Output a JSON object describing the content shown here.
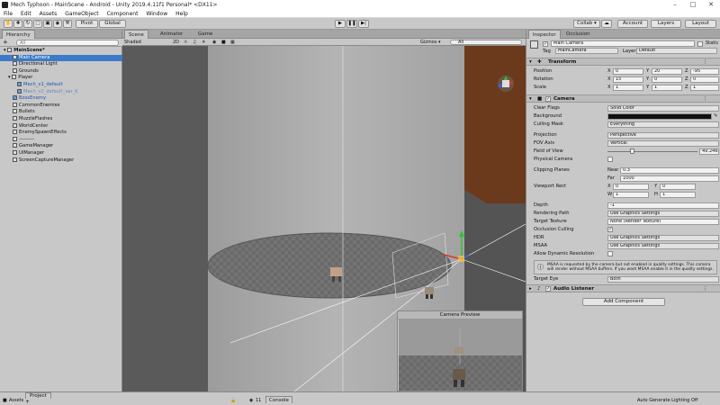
{
  "window": {
    "title": "Mech Typhoon - MainScene - Android - Unity 2019.4.11f1 Personal* <DX11>"
  },
  "menu": [
    "File",
    "Edit",
    "Assets",
    "GameObject",
    "Component",
    "Window",
    "Help"
  ],
  "toolbar": {
    "pivot": "Pivot",
    "global": "Global",
    "collab": "Collab ▾",
    "account": "Account",
    "layers": "Layers",
    "layout": "Layout"
  },
  "hierarchy": {
    "tab": "Hierarchy",
    "create": "+",
    "search_placeholder": "All",
    "items": [
      {
        "label": "MainScene*",
        "depth": 0,
        "kind": "scene"
      },
      {
        "label": "Main Camera",
        "depth": 2,
        "kind": "selected"
      },
      {
        "label": "Directional Light",
        "depth": 2,
        "kind": "normal"
      },
      {
        "label": "Grounds",
        "depth": 2,
        "kind": "normal"
      },
      {
        "label": "Player",
        "depth": 1,
        "kind": "normal"
      },
      {
        "label": "Mech_v1_default",
        "depth": 3,
        "kind": "prefab"
      },
      {
        "label": "Mech_v2_default_var_6",
        "depth": 3,
        "kind": "inactive"
      },
      {
        "label": "BossEnemy",
        "depth": 2,
        "kind": "prefab"
      },
      {
        "label": "CommonEnemies",
        "depth": 2,
        "kind": "normal"
      },
      {
        "label": "Bullets",
        "depth": 2,
        "kind": "normal"
      },
      {
        "label": "MuzzleFlashes",
        "depth": 2,
        "kind": "normal"
      },
      {
        "label": "WorldCenter",
        "depth": 2,
        "kind": "normal"
      },
      {
        "label": "EnemySpawnEffects",
        "depth": 2,
        "kind": "normal"
      },
      {
        "label": "---------",
        "depth": 2,
        "kind": "normal"
      },
      {
        "label": "GameManager",
        "depth": 2,
        "kind": "normal"
      },
      {
        "label": "UIManager",
        "depth": 2,
        "kind": "normal"
      },
      {
        "label": "ScreenCaptureManager",
        "depth": 2,
        "kind": "normal"
      }
    ]
  },
  "scene": {
    "tabs": [
      "Scene",
      "Animator",
      "Game"
    ],
    "shading": "Shaded",
    "mode2d": "2D",
    "gizmos": "Gizmos ▾",
    "search": "All",
    "preview_title": "Camera Preview"
  },
  "inspector": {
    "tabs": [
      "Inspector",
      "Occlusion"
    ],
    "object_name": "Main Camera",
    "static_label": "Static",
    "tag_label": "Tag",
    "tag_value": "MainCamera",
    "layer_label": "Layer",
    "layer_value": "Default",
    "transform": {
      "title": "Transform",
      "position": {
        "label": "Position",
        "x": "0",
        "y": "20",
        "z": "-95"
      },
      "rotation": {
        "label": "Rotation",
        "x": "15",
        "y": "0",
        "z": "0"
      },
      "scale": {
        "label": "Scale",
        "x": "1",
        "y": "1",
        "z": "1"
      }
    },
    "camera": {
      "title": "Camera",
      "clear_flags": {
        "label": "Clear Flags",
        "value": "Solid Color"
      },
      "background": {
        "label": "Background",
        "color": "#111111"
      },
      "culling_mask": {
        "label": "Culling Mask",
        "value": "Everything"
      },
      "projection": {
        "label": "Projection",
        "value": "Perspective"
      },
      "fov_axis": {
        "label": "FOV Axis",
        "value": "Vertical"
      },
      "fov": {
        "label": "Field of View",
        "value": "49.2464",
        "fraction": 0.27
      },
      "physical": {
        "label": "Physical Camera"
      },
      "clipping": {
        "label": "Clipping Planes",
        "near_label": "Near",
        "near": "0.3",
        "far_label": "Far",
        "far": "1000"
      },
      "viewport": {
        "label": "Viewport Rect",
        "x": "0",
        "y": "0",
        "w": "1",
        "h": "1"
      },
      "depth": {
        "label": "Depth",
        "value": "-1"
      },
      "rendering_path": {
        "label": "Rendering Path",
        "value": "Use Graphics Settings"
      },
      "target_texture": {
        "label": "Target Texture",
        "value": "None (Render Texture)"
      },
      "occlusion": {
        "label": "Occlusion Culling"
      },
      "hdr": {
        "label": "HDR",
        "value": "Use Graphics Settings"
      },
      "msaa": {
        "label": "MSAA",
        "value": "Use Graphics Settings"
      },
      "dynres": {
        "label": "Allow Dynamic Resolution"
      },
      "warning": "MSAA is requested by the camera but not enabled in quality settings. This camera will render without MSAA buffers. If you want MSAA enable it in the quality settings.",
      "target_eye": {
        "label": "Target Eye",
        "value": "Both"
      }
    },
    "audio_listener": {
      "title": "Audio Listener"
    },
    "add_component": "Add Component"
  },
  "bottom": {
    "project_tab": "Project",
    "console_tab": "Console",
    "assets": "Assets",
    "count": "11",
    "status": "Auto Generate Lighting Off"
  }
}
